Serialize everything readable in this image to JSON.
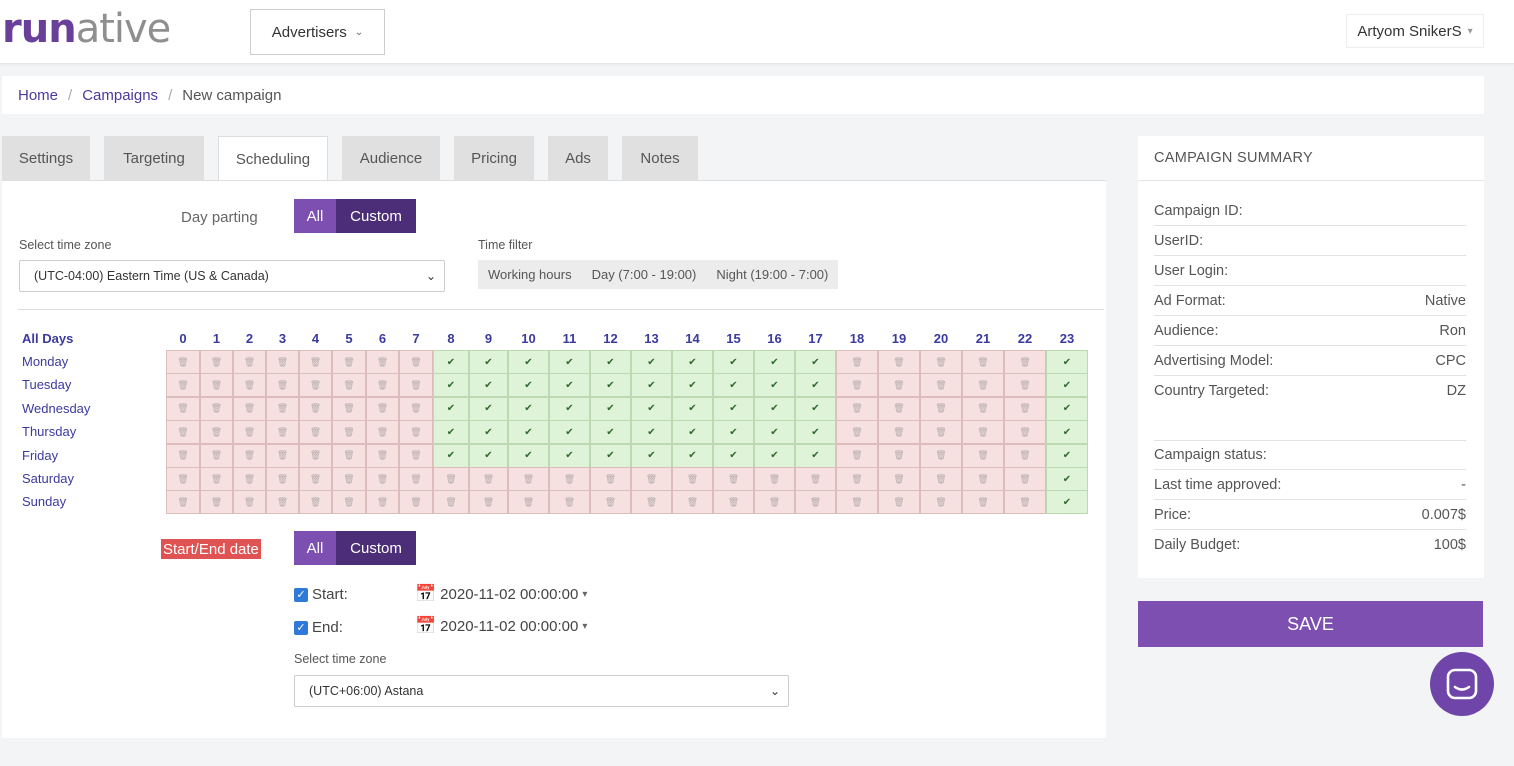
{
  "header": {
    "logo_run": "run",
    "logo_a": "a",
    "logo_tive": "tive",
    "advertisers_label": "Advertisers",
    "user_label": "Artyom SnikerS"
  },
  "breadcrumb": {
    "home": "Home",
    "campaigns": "Campaigns",
    "current": "New campaign",
    "separator": "/"
  },
  "tabs": [
    {
      "label": "Settings",
      "active": false
    },
    {
      "label": "Targeting",
      "active": false
    },
    {
      "label": "Scheduling",
      "active": true
    },
    {
      "label": "Audience",
      "active": false
    },
    {
      "label": "Pricing",
      "active": false
    },
    {
      "label": "Ads",
      "active": false
    },
    {
      "label": "Notes",
      "active": false
    }
  ],
  "scheduling": {
    "day_parting_label": "Day parting",
    "toggle_all": "All",
    "toggle_custom": "Custom",
    "time_zone_label": "Select time zone",
    "time_zone_value": "(UTC-04:00) Eastern Time (US & Canada)",
    "time_filter_label": "Time filter",
    "time_filter_options": [
      "Working hours",
      "Day (7:00 - 19:00)",
      "Night (19:00 - 7:00)"
    ],
    "all_days_label": "All Days",
    "hours": [
      "0",
      "1",
      "2",
      "3",
      "4",
      "5",
      "6",
      "7",
      "8",
      "9",
      "10",
      "11",
      "12",
      "13",
      "14",
      "15",
      "16",
      "17",
      "18",
      "19",
      "20",
      "21",
      "22",
      "23"
    ],
    "days": [
      "Monday",
      "Tuesday",
      "Wednesday",
      "Thursday",
      "Friday",
      "Saturday",
      "Sunday"
    ],
    "schedule": [
      [
        0,
        0,
        0,
        0,
        0,
        0,
        0,
        0,
        1,
        1,
        1,
        1,
        1,
        1,
        1,
        1,
        1,
        1,
        0,
        0,
        0,
        0,
        0,
        1
      ],
      [
        0,
        0,
        0,
        0,
        0,
        0,
        0,
        0,
        1,
        1,
        1,
        1,
        1,
        1,
        1,
        1,
        1,
        1,
        0,
        0,
        0,
        0,
        0,
        1
      ],
      [
        0,
        0,
        0,
        0,
        0,
        0,
        0,
        0,
        1,
        1,
        1,
        1,
        1,
        1,
        1,
        1,
        1,
        1,
        0,
        0,
        0,
        0,
        0,
        1
      ],
      [
        0,
        0,
        0,
        0,
        0,
        0,
        0,
        0,
        1,
        1,
        1,
        1,
        1,
        1,
        1,
        1,
        1,
        1,
        0,
        0,
        0,
        0,
        0,
        1
      ],
      [
        0,
        0,
        0,
        0,
        0,
        0,
        0,
        0,
        1,
        1,
        1,
        1,
        1,
        1,
        1,
        1,
        1,
        1,
        0,
        0,
        0,
        0,
        0,
        1
      ],
      [
        0,
        0,
        0,
        0,
        0,
        0,
        0,
        0,
        0,
        0,
        0,
        0,
        0,
        0,
        0,
        0,
        0,
        0,
        0,
        0,
        0,
        0,
        0,
        1
      ],
      [
        0,
        0,
        0,
        0,
        0,
        0,
        0,
        0,
        0,
        0,
        0,
        0,
        0,
        0,
        0,
        0,
        0,
        0,
        0,
        0,
        0,
        0,
        0,
        1
      ]
    ],
    "on_icon": "check-icon",
    "off_icon": "trash-icon",
    "start_end_label": "Start/End date",
    "start_label": "Start:",
    "start_checked": true,
    "start_value": "2020-11-02 00:00:00",
    "end_label": "End:",
    "end_checked": true,
    "end_value": "2020-11-02 00:00:00",
    "date_time_zone_label": "Select time zone",
    "date_time_zone_value": "(UTC+06:00) Astana"
  },
  "summary": {
    "title": "CAMPAIGN SUMMARY",
    "rows": [
      {
        "label": "Campaign ID:",
        "value": ""
      },
      {
        "label": "UserID:",
        "value": ""
      },
      {
        "label": "User Login:",
        "value": ""
      },
      {
        "label": "Ad Format:",
        "value": "Native"
      },
      {
        "label": "Audience:",
        "value": "Ron"
      },
      {
        "label": "Advertising Model:",
        "value": "CPC"
      },
      {
        "label": "Country Targeted:",
        "value": "DZ"
      },
      {
        "label": "Campaign status:",
        "value": ""
      },
      {
        "label": "Last time approved:",
        "value": "-"
      },
      {
        "label": "Price:",
        "value": "0.007$"
      },
      {
        "label": "Daily Budget:",
        "value": "100$"
      }
    ],
    "save_label": "SAVE"
  },
  "colors": {
    "brand_purple": "#7c4fb0",
    "dark_purple": "#4c2e78",
    "on_cell": "#dff3d8",
    "off_cell": "#f6e0e0",
    "alert_red": "#e05353"
  }
}
